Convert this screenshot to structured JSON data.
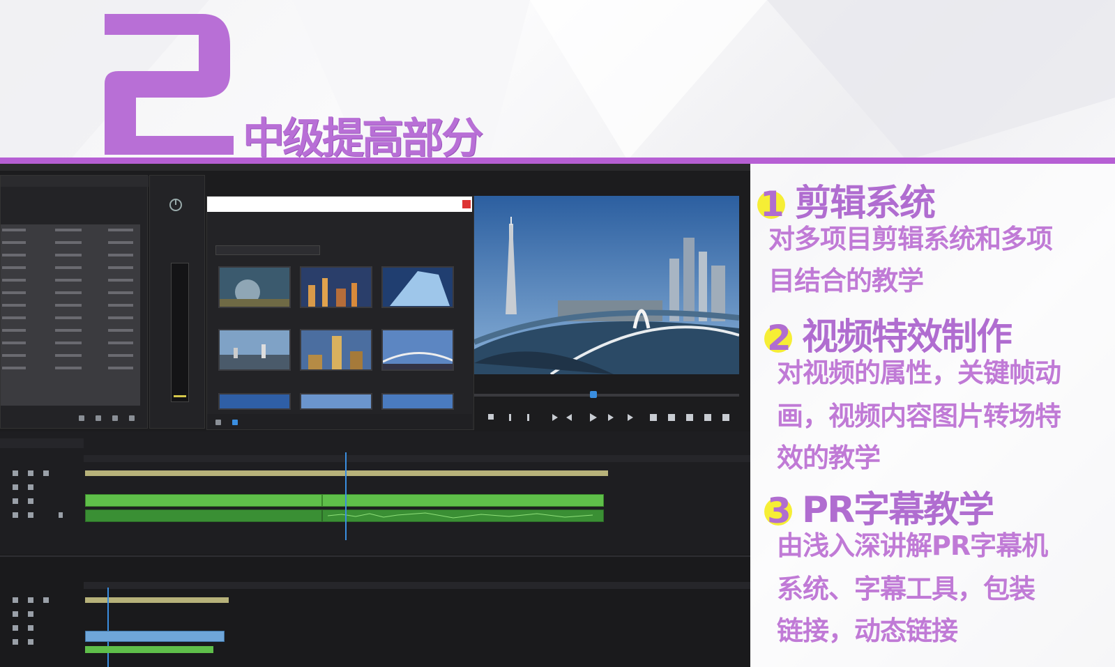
{
  "header": {
    "big_numeral": "2",
    "title": "中级提高部分"
  },
  "colors": {
    "accent_purple": "#b65fd4",
    "highlight_yellow": "#f6ee35",
    "editor_bg": "#1c1c1e",
    "clip_green": "#5fbf4a",
    "playhead_blue": "#3a8ee0"
  },
  "sections": [
    {
      "number": "1",
      "heading": "剪辑系统",
      "lines": [
        "对多项目剪辑系统和多项",
        "目结合的教学"
      ]
    },
    {
      "number": "2",
      "heading": "视频特效制作",
      "lines": [
        "对视频的属性，关键帧动",
        "画，视频内容图片转场特",
        "效的教学"
      ]
    },
    {
      "number": "3",
      "heading": "PR字幕教学",
      "lines": [
        "由浅入深讲解PR字幕机",
        "系统、字幕工具，包装",
        "链接，动态链接"
      ]
    }
  ],
  "editor": {
    "icons": [
      "timer-icon",
      "search-icon",
      "folder-icon",
      "play-icon",
      "wrench-icon",
      "eye-icon",
      "lock-icon",
      "close-icon"
    ]
  }
}
